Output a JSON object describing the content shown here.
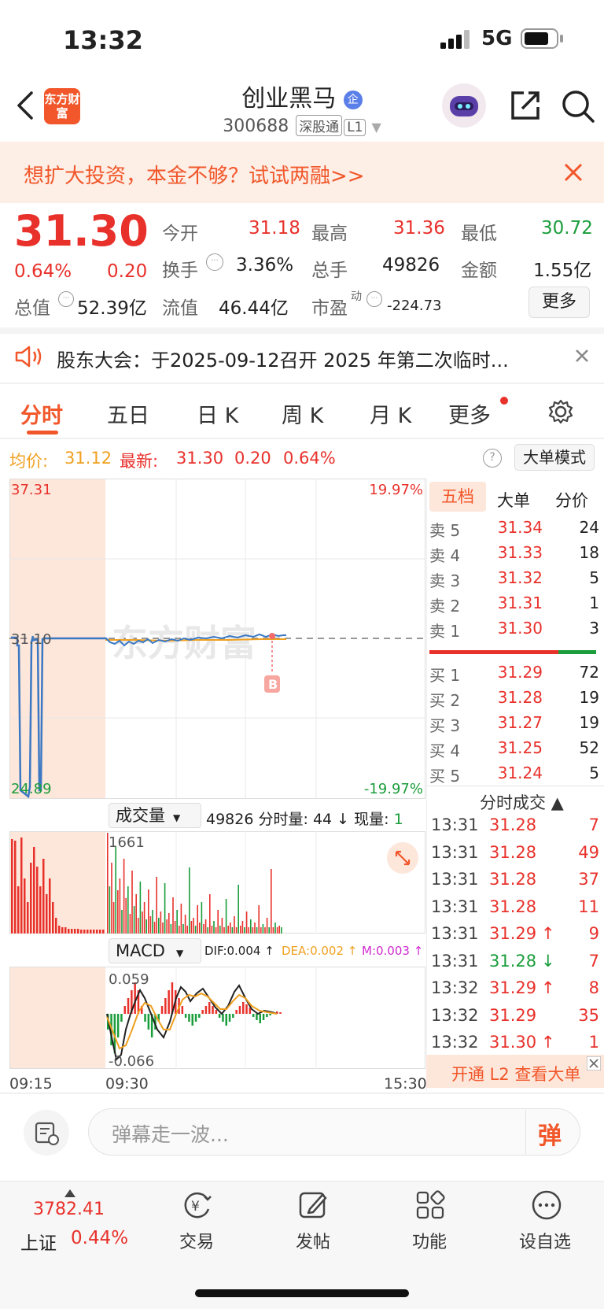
{
  "status": {
    "time": "13:32",
    "network": "5G"
  },
  "header": {
    "logo_text": "东方财富",
    "title": "创业黑马",
    "title_badge": "企",
    "code": "300688",
    "tag1": "深股通",
    "tag2": "L1"
  },
  "banner": {
    "text": "想扩大投资，本金不够？试试两融>>"
  },
  "quote": {
    "price": "31.30",
    "change_pct": "0.64%",
    "change": "0.20",
    "open_label": "今开",
    "open": "31.18",
    "high_label": "最高",
    "high": "31.36",
    "low_label": "最低",
    "low": "30.72",
    "turnover_label": "换手",
    "turnover": "3.36%",
    "volume_label": "总手",
    "volume": "49826",
    "amount_label": "金额",
    "amount": "1.55亿",
    "mcap_label": "总值",
    "mcap": "52.39亿",
    "float_label": "流值",
    "float_cap": "46.44亿",
    "pe_label": "市盈",
    "pe_sup": "动",
    "pe": "-224.73",
    "more": "更多"
  },
  "notice": {
    "text": "股东大会：于2025-09-12召开 2025 年第二次临时..."
  },
  "tabs": [
    "分时",
    "五日",
    "日 K",
    "周 K",
    "月 K",
    "更多"
  ],
  "summary": {
    "avg_label": "均价:",
    "avg": "31.12",
    "latest_label": "最新:",
    "latest": "31.30",
    "chg": "0.20",
    "chg_pct": "0.64%",
    "mode_button": "大单模式"
  },
  "chart_labels": {
    "top_price": "37.31",
    "top_pct": "19.97%",
    "mid_price": "31.10",
    "bottom_price": "24.89",
    "bottom_pct": "-19.97%",
    "watermark": "东方财富",
    "buy_marker": "B",
    "vol_select": "成交量",
    "vol_total": "49826",
    "vol_minute_label": "分时量:",
    "vol_minute": "44",
    "vol_now_label": "现量:",
    "vol_now": "1",
    "vol_max": "1661",
    "macd_select": "MACD",
    "dif": "DIF:0.004 ↑",
    "dea": "DEA:0.002 ↑",
    "m": "M:0.003 ↑",
    "macd_top": "0.059",
    "macd_bottom": "-0.066",
    "time_start": "09:15",
    "time_open": "09:30",
    "time_end": "15:30"
  },
  "orderbook": {
    "tabs": [
      "五档",
      "大单",
      "分价"
    ],
    "asks": [
      {
        "label": "卖 5",
        "price": "31.34",
        "vol": "24"
      },
      {
        "label": "卖 4",
        "price": "31.33",
        "vol": "18"
      },
      {
        "label": "卖 3",
        "price": "31.32",
        "vol": "5"
      },
      {
        "label": "卖 2",
        "price": "31.31",
        "vol": "1"
      },
      {
        "label": "卖 1",
        "price": "31.30",
        "vol": "3"
      }
    ],
    "bids": [
      {
        "label": "买 1",
        "price": "31.29",
        "vol": "72"
      },
      {
        "label": "买 2",
        "price": "31.28",
        "vol": "19"
      },
      {
        "label": "买 3",
        "price": "31.27",
        "vol": "19"
      },
      {
        "label": "买 4",
        "price": "31.25",
        "vol": "52"
      },
      {
        "label": "买 5",
        "price": "31.24",
        "vol": "5"
      }
    ]
  },
  "trades": {
    "header": "分时成交 ▲",
    "rows": [
      {
        "time": "13:31",
        "price": "31.28",
        "vol": "7",
        "dir": "",
        "color": "red"
      },
      {
        "time": "13:31",
        "price": "31.28",
        "vol": "49",
        "dir": "",
        "color": "red"
      },
      {
        "time": "13:31",
        "price": "31.28",
        "vol": "37",
        "dir": "",
        "color": "red"
      },
      {
        "time": "13:31",
        "price": "31.28",
        "vol": "11",
        "dir": "",
        "color": "red"
      },
      {
        "time": "13:31",
        "price": "31.29",
        "vol": "9",
        "dir": "↑",
        "color": "red"
      },
      {
        "time": "13:31",
        "price": "31.28",
        "vol": "7",
        "dir": "↓",
        "color": "green"
      },
      {
        "time": "13:32",
        "price": "31.29",
        "vol": "8",
        "dir": "↑",
        "color": "red"
      },
      {
        "time": "13:32",
        "price": "31.29",
        "vol": "35",
        "dir": "",
        "color": "red"
      },
      {
        "time": "13:32",
        "price": "31.30",
        "vol": "1",
        "dir": "↑",
        "color": "red"
      }
    ],
    "l2_banner": "开通 L2 查看大单"
  },
  "danmu": {
    "placeholder": "弹幕走一波...",
    "send": "弹"
  },
  "bottom_nav": {
    "index_value": "3782.41",
    "index_name": "上证",
    "index_pct": "0.44%",
    "items": [
      "交易",
      "发帖",
      "功能",
      "设自选"
    ]
  }
}
